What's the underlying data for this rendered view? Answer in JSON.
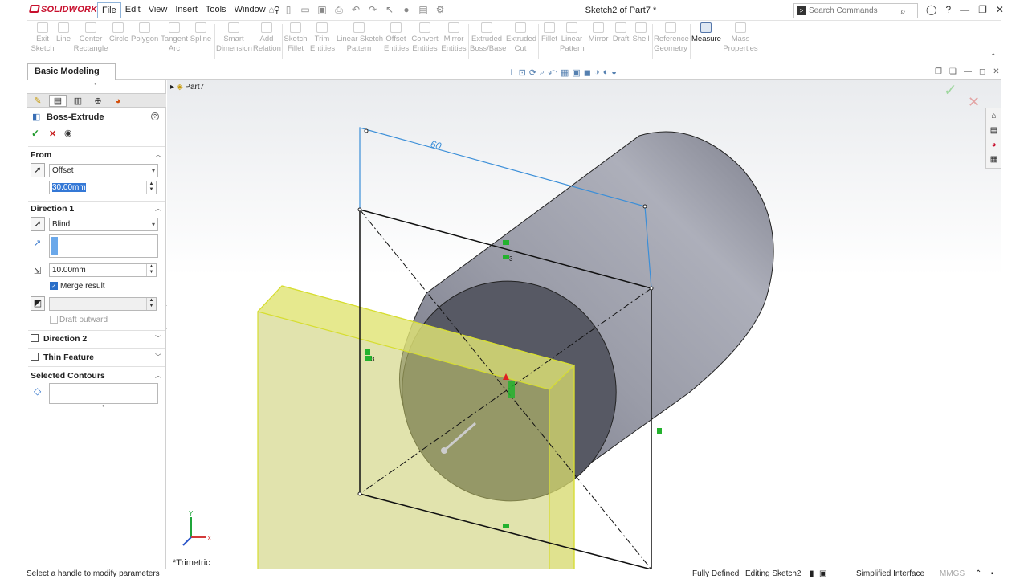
{
  "app": {
    "logo": "SOLIDWORKS",
    "document_title": "Sketch2 of Part7 *"
  },
  "menu": [
    "File",
    "Edit",
    "View",
    "Insert",
    "Tools",
    "Window"
  ],
  "search": {
    "placeholder": "Search Commands"
  },
  "ribbon": {
    "buttons": [
      {
        "label": "Exit\nSketch",
        "enabled": false
      },
      {
        "label": "Line",
        "enabled": false
      },
      {
        "label": "Center\nRectangle",
        "enabled": false
      },
      {
        "label": "Circle",
        "enabled": false
      },
      {
        "label": "Polygon",
        "enabled": false
      },
      {
        "label": "Tangent\nArc",
        "enabled": false
      },
      {
        "label": "Spline",
        "enabled": false
      },
      {
        "label": "Smart\nDimension",
        "enabled": false
      },
      {
        "label": "Add\nRelation",
        "enabled": false
      },
      {
        "label": "Sketch\nFillet",
        "enabled": false
      },
      {
        "label": "Trim\nEntities",
        "enabled": false
      },
      {
        "label": "Linear Sketch\nPattern",
        "enabled": false
      },
      {
        "label": "Offset\nEntities",
        "enabled": false
      },
      {
        "label": "Convert\nEntities",
        "enabled": false
      },
      {
        "label": "Mirror\nEntities",
        "enabled": false
      },
      {
        "label": "Extruded\nBoss/Base",
        "enabled": false
      },
      {
        "label": "Extruded\nCut",
        "enabled": false
      },
      {
        "label": "Fillet",
        "enabled": false
      },
      {
        "label": "Linear\nPattern",
        "enabled": false
      },
      {
        "label": "Mirror",
        "enabled": false
      },
      {
        "label": "Draft",
        "enabled": false
      },
      {
        "label": "Shell",
        "enabled": false
      },
      {
        "label": "Reference\nGeometry",
        "enabled": false
      },
      {
        "label": "Measure",
        "enabled": true
      },
      {
        "label": "Mass\nProperties",
        "enabled": false
      }
    ]
  },
  "tabs": {
    "active": "Basic Modeling Tools"
  },
  "feature_tree": {
    "root": "Part7"
  },
  "property_manager": {
    "title": "Boss-Extrude",
    "from": {
      "header": "From",
      "type": "Offset",
      "offset_value": "30.00mm"
    },
    "direction1": {
      "header": "Direction 1",
      "type": "Blind",
      "depth": "10.00mm",
      "merge_result_label": "Merge result",
      "merge_result_checked": true,
      "draft_outward_label": "Draft outward"
    },
    "direction2": {
      "label": "Direction 2"
    },
    "thin_feature": {
      "label": "Thin Feature"
    },
    "selected_contours": {
      "header": "Selected Contours"
    }
  },
  "viewport": {
    "dimension_label": "60",
    "relation_label": "3",
    "view_name": "*Trimetric",
    "triad_axes": [
      "Y",
      "X"
    ]
  },
  "status": {
    "message": "Select a handle to modify parameters",
    "sketch_state": "Fully Defined",
    "editing": "Editing Sketch2",
    "interface": "Simplified Interface",
    "units": "MMGS"
  },
  "colors": {
    "accent": "#2a6fc9",
    "cylinder": "#8e909d",
    "plate": "#d9dd7a",
    "sketch_blue": "#3a8ed8"
  }
}
